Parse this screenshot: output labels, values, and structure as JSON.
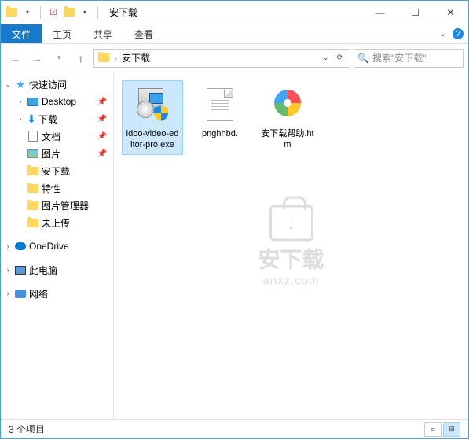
{
  "window": {
    "title": "安下载"
  },
  "ribbon": {
    "tabs": {
      "file": "文件",
      "home": "主页",
      "share": "共享",
      "view": "查看"
    }
  },
  "address": {
    "crumb1": "安下载"
  },
  "search": {
    "placeholder": "搜索\"安下载\""
  },
  "sidebar": {
    "quickaccess": "快速访问",
    "desktop": "Desktop",
    "downloads": "下载",
    "documents": "文档",
    "pictures": "图片",
    "anxz": "安下载",
    "texing": "特性",
    "picmgr": "图片管理器",
    "notuploaded": "未上传",
    "onedrive": "OneDrive",
    "thispc": "此电脑",
    "network": "网络"
  },
  "files": {
    "f0": {
      "name": "idoo-video-editor-pro.exe"
    },
    "f1": {
      "name": "pnghhbd."
    },
    "f2": {
      "name": "安下载帮助.htm"
    }
  },
  "watermark": {
    "title": "安下载",
    "url": "anxz.com"
  },
  "status": {
    "text": "3 个项目"
  }
}
